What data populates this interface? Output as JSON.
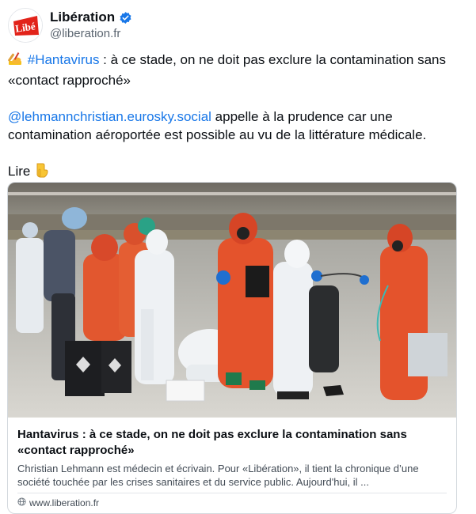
{
  "author": {
    "name": "Libération",
    "handle": "@liberation.fr",
    "avatar_text": "Libé"
  },
  "post": {
    "line1_emoji": "writing-hand-icon",
    "hashtag": "#Hantavirus",
    "line1_text": " : à ce stade, on ne doit pas exclure la contamination sans «contact rapproché»",
    "mention": "@lehmannchristian.eurosky.social",
    "line2_text": " appelle à la prudence car une contamination aéroportée est possible au vu de la littérature médicale.",
    "read_label": "Lire",
    "read_emoji": "pointing-down-icon"
  },
  "card": {
    "image_alt": "Hantavirus",
    "title": "Hantavirus : à ce stade, on ne doit pas exclure la contamination sans «contact rapproché»",
    "description": "Christian Lehmann est médecin et écrivain. Pour «Libération», il tient la chronique d’une société touchée par les crises sanitaires et du service public. Aujourd'hui, il ...",
    "link": "www.liberation.fr"
  },
  "colors": {
    "link": "#1877e8",
    "verified": "#1877e8",
    "brand_red": "#e2231a"
  }
}
